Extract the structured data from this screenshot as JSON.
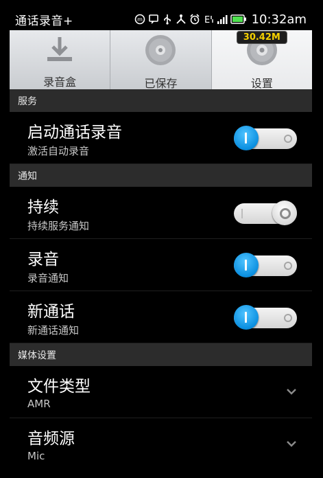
{
  "status_bar": {
    "app_title": "通话录音+",
    "time": "10:32am",
    "icons": [
      "notification-icon",
      "chat-icon",
      "usb-icon",
      "network-share-icon",
      "alarm-icon",
      "e-data-icon",
      "signal-icon",
      "battery-icon"
    ]
  },
  "tabs": [
    {
      "label": "录音盒",
      "icon": "download-tray-icon",
      "active": false
    },
    {
      "label": "已保存",
      "icon": "disc-icon",
      "active": false
    },
    {
      "label": "设置",
      "icon": "settings-disc-icon",
      "active": true,
      "badge": "30.42M"
    }
  ],
  "sections": [
    {
      "header": "服务",
      "rows": [
        {
          "title": "启动通话录音",
          "subtitle": "激活自动录音",
          "control": "toggle",
          "on": true
        }
      ]
    },
    {
      "header": "通知",
      "rows": [
        {
          "title": "持续",
          "subtitle": "持续服务通知",
          "control": "toggle",
          "on": false
        },
        {
          "title": "录音",
          "subtitle": "录音通知",
          "control": "toggle",
          "on": true
        },
        {
          "title": "新通话",
          "subtitle": "新通话通知",
          "control": "toggle",
          "on": true
        }
      ]
    },
    {
      "header": "媒体设置",
      "rows": [
        {
          "title": "文件类型",
          "subtitle": "AMR",
          "control": "dropdown"
        },
        {
          "title": "音频源",
          "subtitle": "Mic",
          "control": "dropdown"
        }
      ]
    }
  ],
  "colors": {
    "toggle_on": "#0b8fe0",
    "section_header_bg": "#2c2c2c",
    "badge_text": "#f5d000"
  }
}
